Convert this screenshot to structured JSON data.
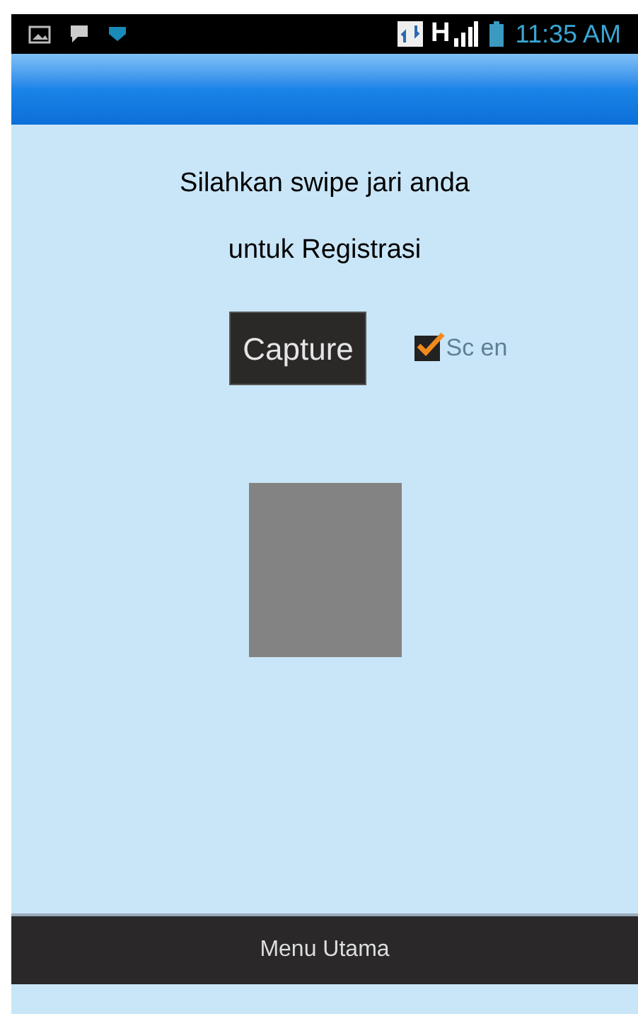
{
  "status_bar": {
    "network": "H",
    "time": "11:35 AM"
  },
  "instructions": [
    "Silahkan swipe jari anda",
    "untuk Registrasi"
  ],
  "capture_button": "Capture",
  "checkbox": {
    "label": "Sc en",
    "checked": true
  },
  "footer_button": "Menu Utama"
}
